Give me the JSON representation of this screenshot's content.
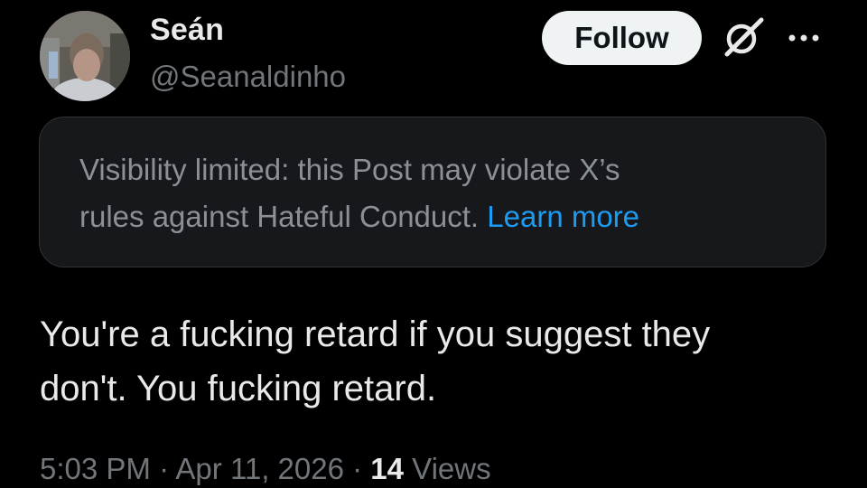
{
  "author": {
    "display_name": "Seán",
    "handle": "@Seanaldinho"
  },
  "header_actions": {
    "follow_label": "Follow",
    "grok_icon": "grok-icon",
    "more_icon": "more-horizontal-icon"
  },
  "notice": {
    "line1": "Visibility limited: this Post may violate X’s",
    "line2_prefix": "rules against Hateful Conduct. ",
    "learn_more_label": "Learn more"
  },
  "post": {
    "line1": "You're a fucking retard if you suggest they",
    "line2": "don't. You fucking retard."
  },
  "meta": {
    "time": "5:03 PM",
    "separator1": " · ",
    "date": "Apr 11, 2026",
    "separator2": " · ",
    "views_count": "14",
    "views_label": " Views"
  },
  "colors": {
    "background": "#000000",
    "primary_text": "#e7e9ea",
    "secondary_text": "#71767b",
    "link": "#1d9bf0",
    "follow_button_bg": "#eff3f4",
    "notice_bg": "#16181c"
  }
}
